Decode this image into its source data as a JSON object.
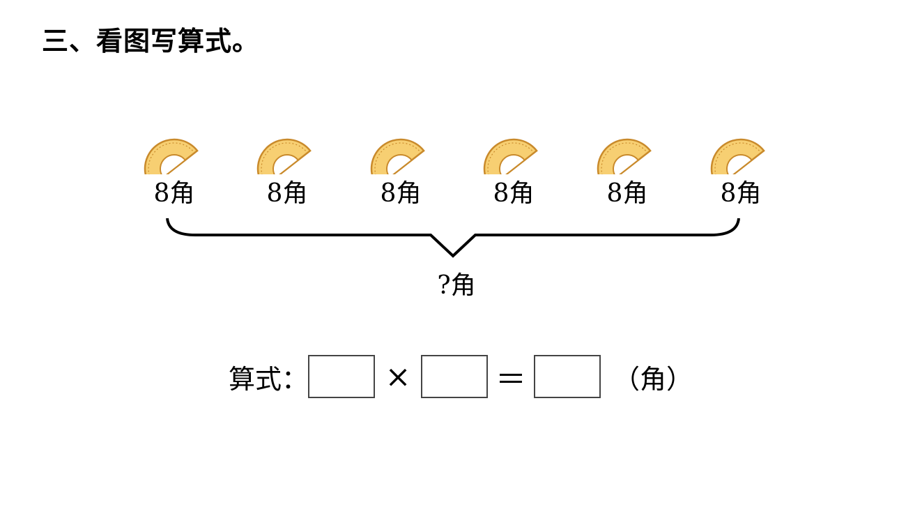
{
  "title": "三、看图写算式。",
  "items": [
    {
      "label": "8角",
      "icon": "protractor-icon"
    },
    {
      "label": "8角",
      "icon": "protractor-icon"
    },
    {
      "label": "8角",
      "icon": "protractor-icon"
    },
    {
      "label": "8角",
      "icon": "protractor-icon"
    },
    {
      "label": "8角",
      "icon": "protractor-icon"
    },
    {
      "label": "8角",
      "icon": "protractor-icon"
    }
  ],
  "total_label": "?角",
  "equation": {
    "prefix": "算式：",
    "times": "×",
    "equals": "＝",
    "unit": "（角）"
  },
  "colors": {
    "protractor_fill": "#F7CF72",
    "protractor_stroke": "#C98A2B"
  }
}
